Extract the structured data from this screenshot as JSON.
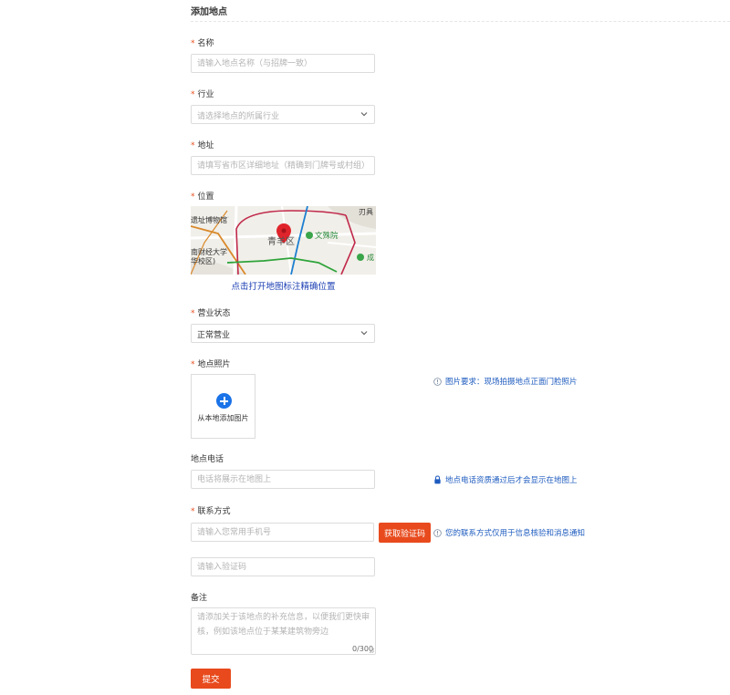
{
  "page": {
    "title": "添加地点"
  },
  "form": {
    "required_mark": "*",
    "name": {
      "label": "名称",
      "placeholder": "请输入地点名称（与招牌一致）"
    },
    "industry": {
      "label": "行业",
      "placeholder": "请选择地点的所属行业"
    },
    "address": {
      "label": "地址",
      "placeholder": "请填写省市区详细地址（精确到门牌号或村组）"
    },
    "location": {
      "label": "位置",
      "map_link": "点击打开地图标注精确位置",
      "map_labels": {
        "museum": "遗址博物馆",
        "district": "青羊区",
        "temple": "文殊院",
        "university_1": "南财经大学",
        "university_2": "华校区)",
        "top_right": "刃具",
        "right_edge": "成"
      }
    },
    "status": {
      "label": "营业状态",
      "value": "正常营业"
    },
    "photo": {
      "label": "地点照片",
      "upload_text": "从本地添加图片",
      "hint": "图片要求：现场拍摄地点正面门脸照片"
    },
    "phone": {
      "label": "地点电话",
      "placeholder": "电话将展示在地图上",
      "hint": "地点电话资质通过后才会显示在地图上"
    },
    "contact": {
      "label": "联系方式",
      "placeholder": "请输入您常用手机号",
      "code_button": "获取验证码",
      "hint": "您的联系方式仅用于信息核验和消息通知",
      "code_placeholder": "请输入验证码"
    },
    "remark": {
      "label": "备注",
      "placeholder": "请添加关于该地点的补充信息，以便我们更快审核，例如该地点位于某某建筑物旁边",
      "counter": "0/300"
    },
    "submit": "提交"
  },
  "colors": {
    "accent": "#e84a1d",
    "link": "#1e40b4",
    "hint": "#1e5bbf",
    "upload_icon": "#1a73e8"
  },
  "icons": {
    "chevron": "chevron-down-icon",
    "info": "info-circle-icon",
    "lock": "lock-icon",
    "pin": "map-pin-icon",
    "plus": "plus-circle-icon"
  }
}
